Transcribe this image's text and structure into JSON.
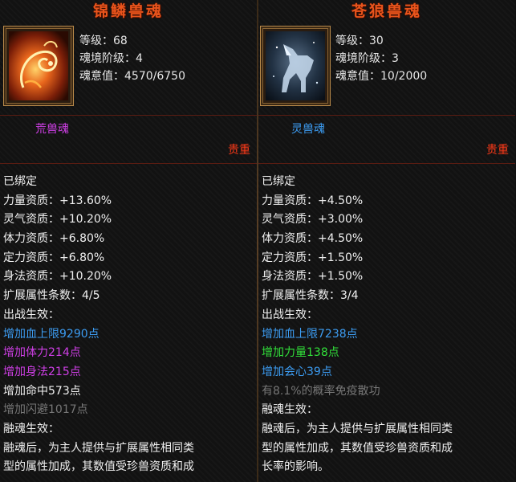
{
  "left": {
    "title": "锦鳞兽魂",
    "portrait_icon": "fire-fish-icon",
    "stats": [
      "等级：68",
      "魂境阶级：4",
      "魂意值：4570/6750"
    ],
    "soul_type": "荒兽魂",
    "soul_type_color": "#cf3fe6",
    "rarity": "贵重",
    "lines": [
      {
        "text": "已绑定",
        "color": "white"
      },
      {
        "text": "力量资质：+13.60%",
        "color": "white"
      },
      {
        "text": "灵气资质：+10.20%",
        "color": "white"
      },
      {
        "text": "体力资质：+6.80%",
        "color": "white"
      },
      {
        "text": "定力资质：+6.80%",
        "color": "white"
      },
      {
        "text": "身法资质：+10.20%",
        "color": "white"
      },
      {
        "text": "扩展属性条数：4/5",
        "color": "white"
      },
      {
        "text": "出战生效：",
        "color": "white"
      },
      {
        "text": "增加血上限9290点",
        "color": "blue"
      },
      {
        "text": "增加体力214点",
        "color": "purple"
      },
      {
        "text": "增加身法215点",
        "color": "purple"
      },
      {
        "text": "增加命中573点",
        "color": "white"
      },
      {
        "text": "增加闪避1017点",
        "color": "grey"
      },
      {
        "text": "融魂生效：",
        "color": "white"
      },
      {
        "text": "融魂后，为主人提供与扩展属性相同类",
        "color": "white"
      },
      {
        "text": "型的属性加成，其数值受珍兽资质和成",
        "color": "white"
      }
    ]
  },
  "right": {
    "title": "苍狼兽魂",
    "portrait_icon": "wolf-icon",
    "stats": [
      "等级：30",
      "魂境阶级：3",
      "魂意值：10/2000"
    ],
    "soul_type": "灵兽魂",
    "soul_type_color": "#3c9cf2",
    "rarity": "贵重",
    "lines": [
      {
        "text": "已绑定",
        "color": "white"
      },
      {
        "text": "力量资质：+4.50%",
        "color": "white"
      },
      {
        "text": "灵气资质：+3.00%",
        "color": "white"
      },
      {
        "text": "体力资质：+4.50%",
        "color": "white"
      },
      {
        "text": "定力资质：+1.50%",
        "color": "white"
      },
      {
        "text": "身法资质：+1.50%",
        "color": "white"
      },
      {
        "text": "扩展属性条数：3/4",
        "color": "white"
      },
      {
        "text": "出战生效：",
        "color": "white"
      },
      {
        "text": "增加血上限7238点",
        "color": "blue"
      },
      {
        "text": "增加力量138点",
        "color": "green"
      },
      {
        "text": "增加会心39点",
        "color": "blue"
      },
      {
        "text": "有8.1%的概率免疫散功",
        "color": "grey"
      },
      {
        "text": "融魂生效：",
        "color": "white"
      },
      {
        "text": "融魂后，为主人提供与扩展属性相同类",
        "color": "white"
      },
      {
        "text": "型的属性加成，其数值受珍兽资质和成",
        "color": "white"
      },
      {
        "text": "长率的影响。",
        "color": "white"
      }
    ]
  }
}
